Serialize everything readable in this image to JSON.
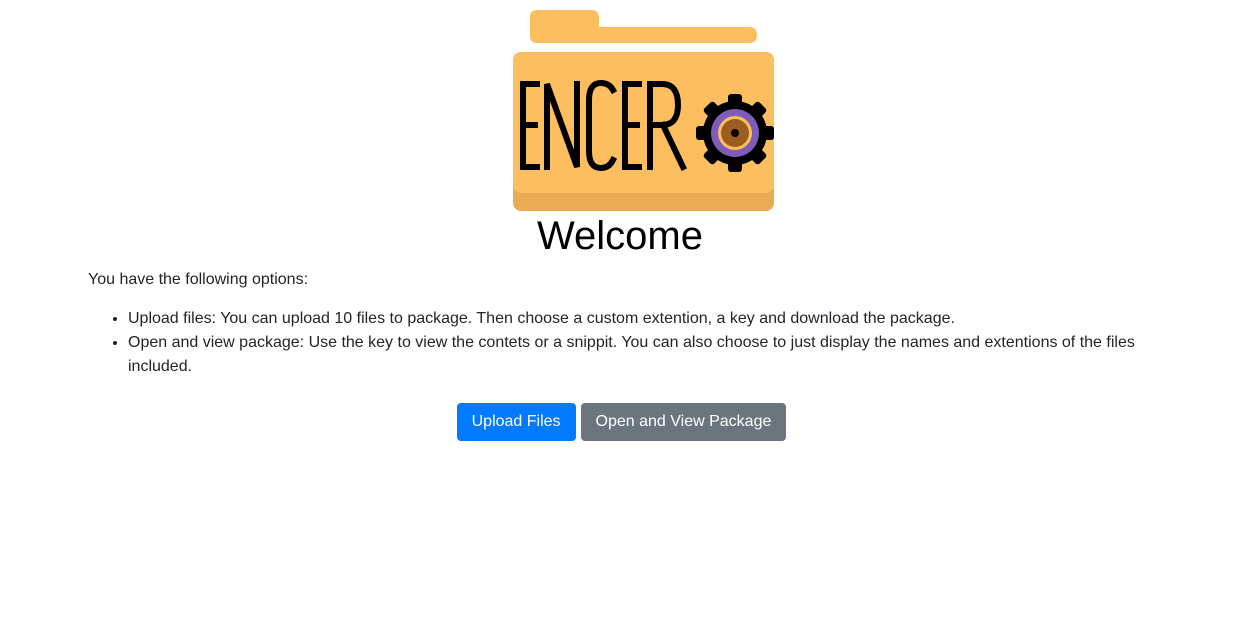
{
  "logo": {
    "text": "ENCER",
    "colors": {
      "folder": "#FCBE5E",
      "folder_shadow": "#E9AC55",
      "gear": "#000000",
      "ring_outer": "#7E5CB8",
      "ring_inner": "#9C5E1E",
      "center": "#000000"
    }
  },
  "heading": "Welcome",
  "intro": "You have the following options:",
  "options": [
    "Upload files: You can upload 10 files to package. Then choose a custom extention, a key and download the package.",
    "Open and view package: Use the key to view the contets or a snippit. You can also choose to just display the names and extentions of the files included."
  ],
  "buttons": {
    "upload": "Upload Files",
    "open": "Open and View Package"
  },
  "colors": {
    "primary": "#007bff",
    "secondary": "#6c757d"
  }
}
